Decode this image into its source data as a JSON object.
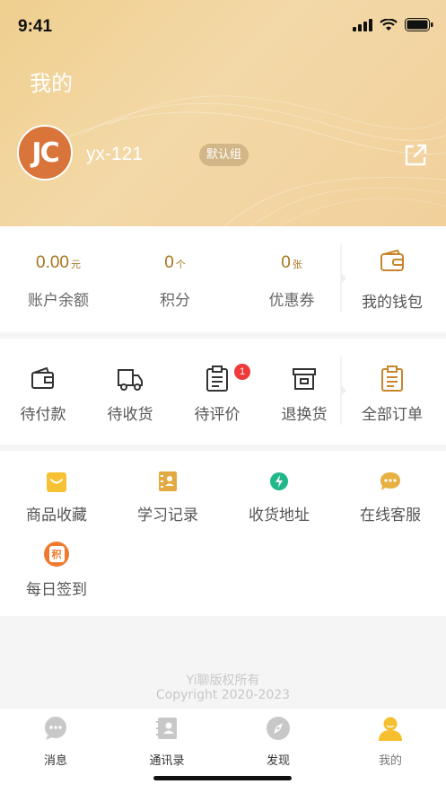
{
  "status_bar": {
    "time": "9:41"
  },
  "header": {
    "title": "我的",
    "avatar_initials": "JC",
    "username": "yx-121",
    "group_badge": "默认组",
    "share_icon": "external-link-icon"
  },
  "account": {
    "balance": {
      "value": "0.00",
      "unit": "元",
      "label": "账户余额"
    },
    "points": {
      "value": "0",
      "unit": "个",
      "label": "积分"
    },
    "coupons": {
      "value": "0",
      "unit": "张",
      "label": "优惠券"
    },
    "wallet": {
      "label": "我的钱包",
      "icon": "wallet-icon"
    }
  },
  "orders": {
    "items": [
      {
        "label": "待付款",
        "icon": "wallet-outline-icon"
      },
      {
        "label": "待收货",
        "icon": "truck-icon"
      },
      {
        "label": "待评价",
        "icon": "clipboard-icon",
        "badge": "1"
      },
      {
        "label": "退换货",
        "icon": "archive-box-icon"
      }
    ],
    "all": {
      "label": "全部订单",
      "icon": "clipboard-list-icon"
    }
  },
  "services": {
    "items": [
      {
        "label": "商品收藏",
        "icon": "shopping-bag-icon"
      },
      {
        "label": "学习记录",
        "icon": "contact-book-icon"
      },
      {
        "label": "收货地址",
        "icon": "location-icon"
      },
      {
        "label": "在线客服",
        "icon": "chat-icon"
      },
      {
        "label": "每日签到",
        "icon": "sign-in-icon",
        "icon_text": "积"
      }
    ]
  },
  "footer": {
    "line1": "Yi聊版权所有",
    "line2": "Copyright 2020-2023"
  },
  "tabbar": {
    "items": [
      {
        "label": "消息",
        "icon": "message-icon"
      },
      {
        "label": "通讯录",
        "icon": "contacts-icon"
      },
      {
        "label": "发现",
        "icon": "compass-icon"
      },
      {
        "label": "我的",
        "icon": "user-icon",
        "active": true
      }
    ]
  },
  "colors": {
    "accent_gold": "#a9741f",
    "header_gradient_start": "#f0cf8f",
    "badge_red": "#f0393a"
  }
}
